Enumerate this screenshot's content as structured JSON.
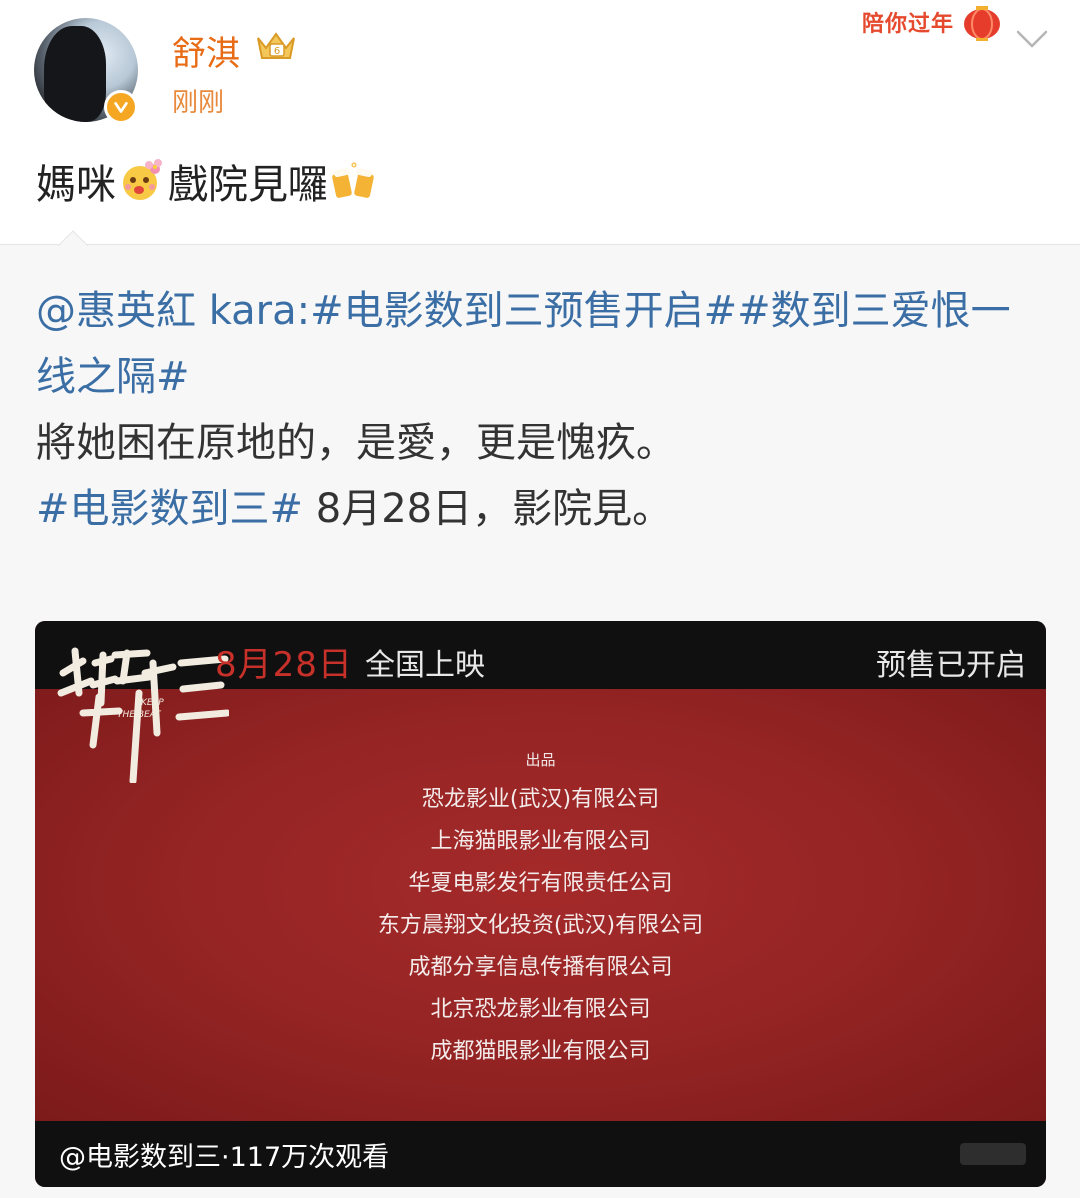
{
  "author": {
    "name": "舒淇",
    "time": "刚刚"
  },
  "festival_badge": "陪你过年",
  "post": {
    "text_part1": "媽咪",
    "text_part2": "戲院見囉"
  },
  "repost": {
    "mention": "@惠英紅 kara:",
    "tag1": "#电影数到三预售开启#",
    "tag2": "#数到三爱恨一线之隔#",
    "line2": "將她困在原地的，是愛，更是愧疚。",
    "tag3": "#电影数到三#",
    "line3": " 8月28日，影院見。"
  },
  "video": {
    "release_date": "8月28日",
    "nationwide": "全国上映",
    "presale": "预售已开启",
    "credits_heading": "出品",
    "credits": [
      "恐龙影业(武汉)有限公司",
      "上海猫眼影业有限公司",
      "华夏电影发行有限责任公司",
      "东方晨翔文化投资(武汉)有限公司",
      "成都分享信息传播有限公司",
      "北京恐龙影业有限公司",
      "成都猫眼影业有限公司"
    ],
    "caption": "@电影数到三·117万次观看"
  },
  "colors": {
    "username": "#e86c16",
    "link": "#3a6ea5",
    "video_red": "#952424"
  }
}
